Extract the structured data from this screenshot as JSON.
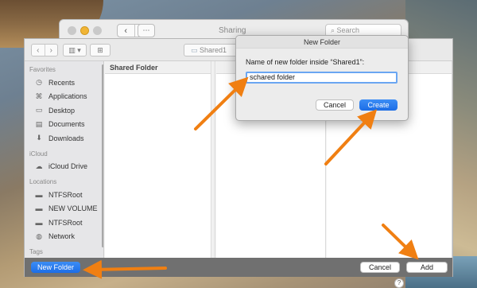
{
  "sharing_window": {
    "title": "Sharing",
    "nav_back": "‹",
    "nav_forward": "›",
    "grid_icon": "⋯",
    "search_placeholder": "Search"
  },
  "panel": {
    "toolbar": {
      "back": "‹",
      "forward": "›",
      "view_icon": "▥ ▾",
      "new_folder_icon": "⊞",
      "path_label": "Shared1"
    },
    "sidebar": {
      "sections": [
        {
          "header": "Favorites",
          "items": [
            {
              "label": "Recents",
              "icon": "clock-icon"
            },
            {
              "label": "Applications",
              "icon": "applications-icon"
            },
            {
              "label": "Desktop",
              "icon": "desktop-icon"
            },
            {
              "label": "Documents",
              "icon": "document-icon"
            },
            {
              "label": "Downloads",
              "icon": "download-icon"
            }
          ]
        },
        {
          "header": "iCloud",
          "items": [
            {
              "label": "iCloud Drive",
              "icon": "cloud-icon"
            }
          ]
        },
        {
          "header": "Locations",
          "items": [
            {
              "label": "NTFSRoot",
              "icon": "drive-icon"
            },
            {
              "label": "NEW VOLUME",
              "icon": "drive-icon"
            },
            {
              "label": "NTFSRoot",
              "icon": "drive-icon"
            },
            {
              "label": "Network",
              "icon": "network-icon"
            }
          ]
        },
        {
          "header": "Tags",
          "items": []
        }
      ]
    },
    "columns": [
      {
        "header": "Shared Folder"
      }
    ],
    "bottom_bar": {
      "new_folder_label": "New Folder",
      "cancel_label": "Cancel",
      "add_label": "Add"
    }
  },
  "dialog": {
    "title": "New Folder",
    "prompt": "Name of new folder inside “Shared1”:",
    "input_value": "schared folder",
    "cancel_label": "Cancel",
    "create_label": "Create"
  },
  "help_label": "?",
  "colors": {
    "accent_blue": "#1c6de6",
    "annotation_arrow": "#f07f12"
  }
}
